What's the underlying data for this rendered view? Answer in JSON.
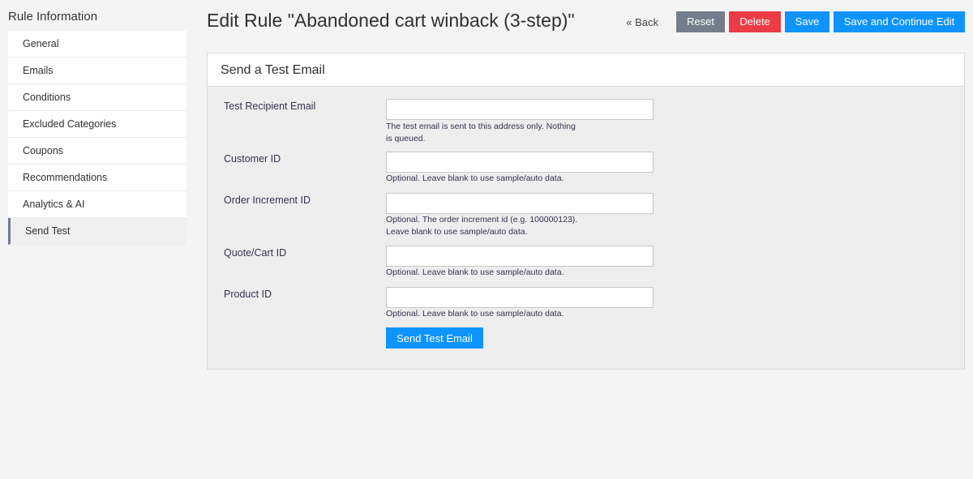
{
  "sidebar": {
    "title": "Rule Information",
    "items": [
      {
        "label": "General"
      },
      {
        "label": "Emails"
      },
      {
        "label": "Conditions"
      },
      {
        "label": "Excluded Categories"
      },
      {
        "label": "Coupons"
      },
      {
        "label": "Recommendations"
      },
      {
        "label": "Analytics & AI"
      },
      {
        "label": "Send Test"
      }
    ],
    "active_item": "Send Test"
  },
  "header": {
    "title": "Edit Rule \"Abandoned cart winback (3-step)\""
  },
  "toolbar": {
    "back_label": "« Back",
    "reset_label": "Reset",
    "delete_label": "Delete",
    "save_label": "Save",
    "save_continue_label": "Save and Continue Edit"
  },
  "panel": {
    "title": "Send a Test Email",
    "fields": [
      {
        "label": "Test Recipient Email",
        "value": "",
        "hint_line1": "The test email is sent to this address only. Nothing",
        "hint_line2": "is queued."
      },
      {
        "label": "Customer ID",
        "value": "",
        "hint_line1": "Optional. Leave blank to use sample/auto data."
      },
      {
        "label": "Order Increment ID",
        "value": "",
        "hint_line1": "Optional. The order increment id (e.g. 100000123).",
        "hint_line2": "Leave blank to use sample/auto data."
      },
      {
        "label": "Quote/Cart ID",
        "value": "",
        "hint_line1": "Optional. Leave blank to use sample/auto data."
      },
      {
        "label": "Product ID",
        "value": "",
        "hint_line1": "Optional. Leave blank to use sample/auto data."
      }
    ],
    "send_button_label": "Send Test Email"
  },
  "colors": {
    "primary": "#0e94ff",
    "danger": "#eb3b45",
    "secondary": "#747d8c",
    "background": "#f4f4f4"
  }
}
